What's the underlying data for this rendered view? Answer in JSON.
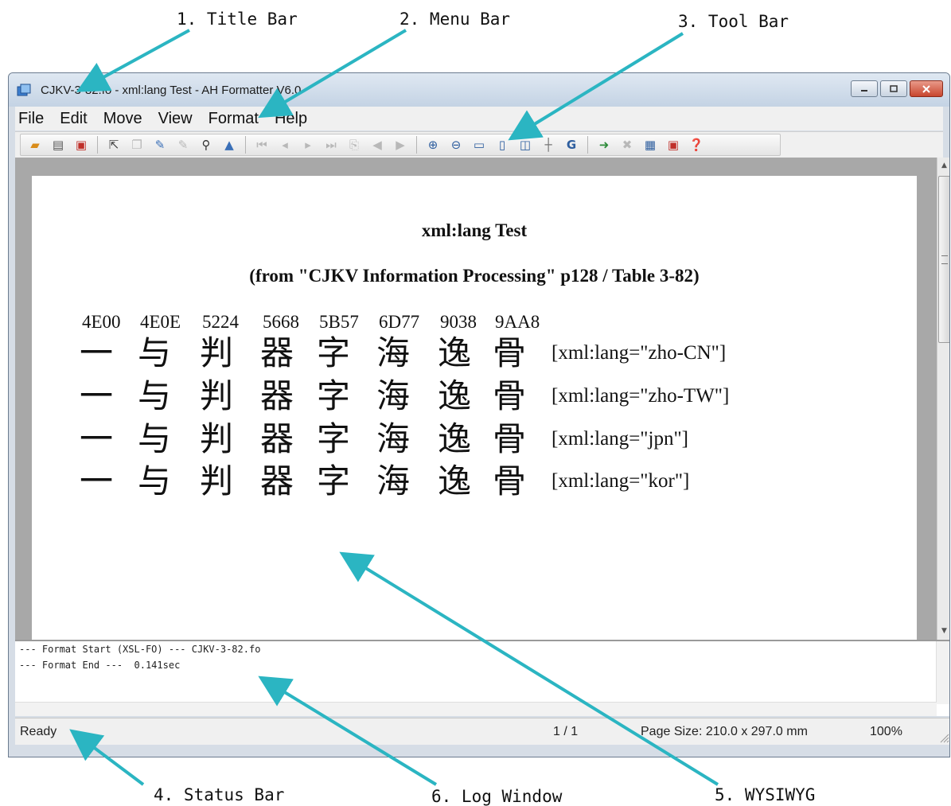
{
  "callouts": {
    "title_bar": "1. Title Bar",
    "menu_bar": "2. Menu Bar",
    "tool_bar": "3. Tool Bar",
    "status_bar": "4. Status Bar",
    "wysiwyg": "5. WYSIWYG",
    "log_window": "6. Log Window"
  },
  "window": {
    "title": "CJKV-3-82.fo - xml:lang Test - AH Formatter V6.0"
  },
  "menu": [
    "File",
    "Edit",
    "Move",
    "View",
    "Format",
    "Help"
  ],
  "toolbar": {
    "buttons": [
      "open-icon",
      "print-icon",
      "pdf-icon",
      "select-icon",
      "copy-icon",
      "edit-icon",
      "edit2-icon",
      "find-icon",
      "chart-icon",
      "first-page-icon",
      "prev-page-icon",
      "next-page-icon",
      "last-page-icon",
      "goto-page-icon",
      "back-icon",
      "forward-icon",
      "zoom-in-icon",
      "zoom-out-icon",
      "fit-width-icon",
      "fit-page-icon",
      "two-page-icon",
      "crosshair-icon",
      "grid-icon",
      "format-icon",
      "stop-icon",
      "option-icon",
      "export-pdf-icon",
      "help-icon"
    ]
  },
  "document": {
    "title": "xml:lang Test",
    "subtitle": "(from \"CJKV Information Processing\" p128 / Table 3-82)",
    "codes": [
      "4E00",
      "4E0E",
      "5224",
      "5668",
      "5B57",
      "6D77",
      "9038",
      "9AA8"
    ],
    "chars": [
      "一",
      "与",
      "判",
      "器",
      "字",
      "海",
      "逸",
      "骨"
    ],
    "rows": [
      {
        "label": "[xml:lang=\"zho-CN\"]"
      },
      {
        "label": "[xml:lang=\"zho-TW\"]"
      },
      {
        "label": "[xml:lang=\"jpn\"]"
      },
      {
        "label": "[xml:lang=\"kor\"]"
      }
    ]
  },
  "log": {
    "line1": "--- Format Start (XSL-FO) --- CJKV-3-82.fo",
    "line2": "--- Format End ---  0.141sec"
  },
  "status": {
    "text": "Ready",
    "page": "1 / 1",
    "page_size": "Page Size: 210.0 x 297.0 mm",
    "zoom": "100%"
  }
}
